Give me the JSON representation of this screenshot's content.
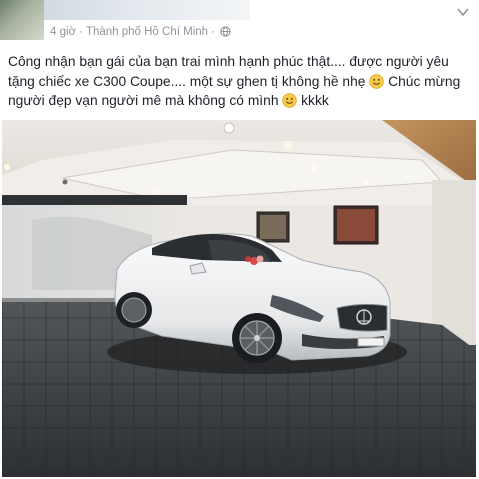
{
  "post": {
    "time": "4 giờ",
    "separator": "·",
    "location": "Thành phố Hồ Chí Minh",
    "privacy_icon": "globe-icon",
    "menu_icon": "chevron-down-icon",
    "text_part1": "Công nhận bạn gái của bạn trai mình hạnh phúc thật.... được người yêu tặng chiếc xe C300 Coupe.... một sự ghen tị không hề nhẹ ",
    "text_part2": " Chúc mừng người đẹp vạn người mê mà không có mình ",
    "text_part3": " kkkk",
    "emoji_icon": "smiley-icon"
  },
  "photo": {
    "subject": "white coupe in garage",
    "colors": {
      "car": "#f4f5f6",
      "floor": "#3a3d40",
      "wall": "#e9e6e2",
      "ceiling": "#f2f0ec",
      "wood": "#b88a5a"
    }
  }
}
